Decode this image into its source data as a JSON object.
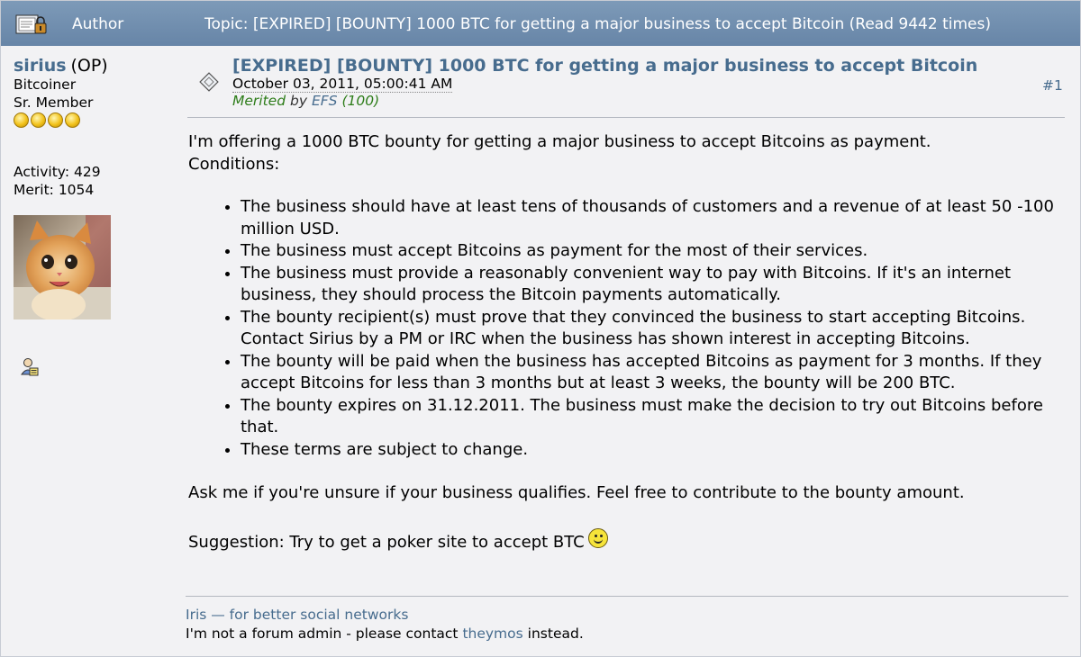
{
  "header": {
    "author_label": "Author",
    "topic_title": "Topic: [EXPIRED] [BOUNTY] 1000 BTC for getting a major business to accept Bitcoin  (Read 9442 times)"
  },
  "poster": {
    "username": "sirius",
    "op_tag": "(OP)",
    "rank_title": "Bitcoiner",
    "rank": "Sr. Member",
    "activity": "Activity: 429",
    "merit": "Merit: 1054"
  },
  "post": {
    "subject": "[EXPIRED] [BOUNTY] 1000 BTC for getting a major business to accept Bitcoin",
    "date": "October 03, 2011, 05:00:41 AM",
    "merited_label": "Merited",
    "merited_by": "by",
    "merited_user": "EFS",
    "merited_amount": "(100)",
    "post_number": "#1",
    "intro_line1": "I'm offering a 1000 BTC bounty for getting a major business to accept Bitcoins as payment.",
    "intro_line2": "Conditions:",
    "conditions": [
      "The business should have at least tens of thousands of customers and a revenue of at least 50 -100 million USD.",
      "The business must accept Bitcoins as payment for the most of their services.",
      "The business must provide a reasonably convenient way to pay with Bitcoins. If it's an internet business, they should process the Bitcoin payments automatically.",
      "The bounty recipient(s) must prove that they convinced the business to start accepting Bitcoins. Contact Sirius by a PM or IRC when the business has shown interest in accepting Bitcoins.",
      "The bounty will be paid when the business has accepted Bitcoins as payment for 3 months. If they accept Bitcoins for less than 3 months but at least 3 weeks, the bounty will be 200 BTC.",
      "The bounty expires on 31.12.2011. The business must make the decision to try out Bitcoins before that.",
      "These terms are subject to change."
    ],
    "ask_line": "Ask me if you're unsure if your business qualifies. Feel free to contribute to the bounty amount.",
    "suggestion": "Suggestion: Try to get a poker site to accept BTC"
  },
  "signature": {
    "link_text": "Iris — for better social networks",
    "line2_prefix": "I'm not a forum admin - please contact",
    "line2_link": "theymos",
    "line2_suffix": "instead."
  },
  "colors": {
    "header_bg": "#6f8cad",
    "link": "#476c8e",
    "merited_green": "#2e7d1a"
  },
  "icons": [
    "lock-icon",
    "post-icon",
    "profile-icon",
    "smiley-icon",
    "star-icon"
  ]
}
